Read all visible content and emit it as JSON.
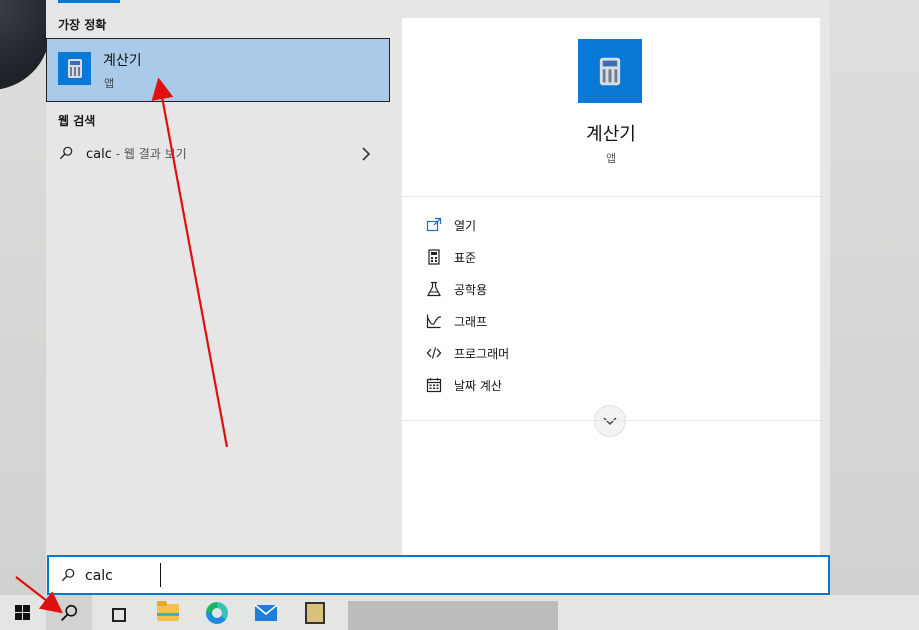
{
  "start_menu": {
    "best_match_header": "가장 정확",
    "best_match": {
      "title": "계산기",
      "subtitle": "앱"
    },
    "web_search_header": "웹 검색",
    "web_result": {
      "query": "calc",
      "suffix": " - 웹 결과 보기"
    }
  },
  "detail": {
    "title": "계산기",
    "subtitle": "앱",
    "actions": [
      {
        "label": "열기",
        "icon": "open-icon"
      },
      {
        "label": "표준",
        "icon": "standard-calculator-icon"
      },
      {
        "label": "공학용",
        "icon": "flask-icon"
      },
      {
        "label": "그래프",
        "icon": "graph-icon"
      },
      {
        "label": "프로그래머",
        "icon": "code-icon"
      },
      {
        "label": "날짜 계산",
        "icon": "calendar-icon"
      }
    ]
  },
  "search": {
    "value": "calc"
  },
  "colors": {
    "accent": "#0078d4",
    "selected": "#a9cbe9",
    "annotation": "#e01010"
  }
}
